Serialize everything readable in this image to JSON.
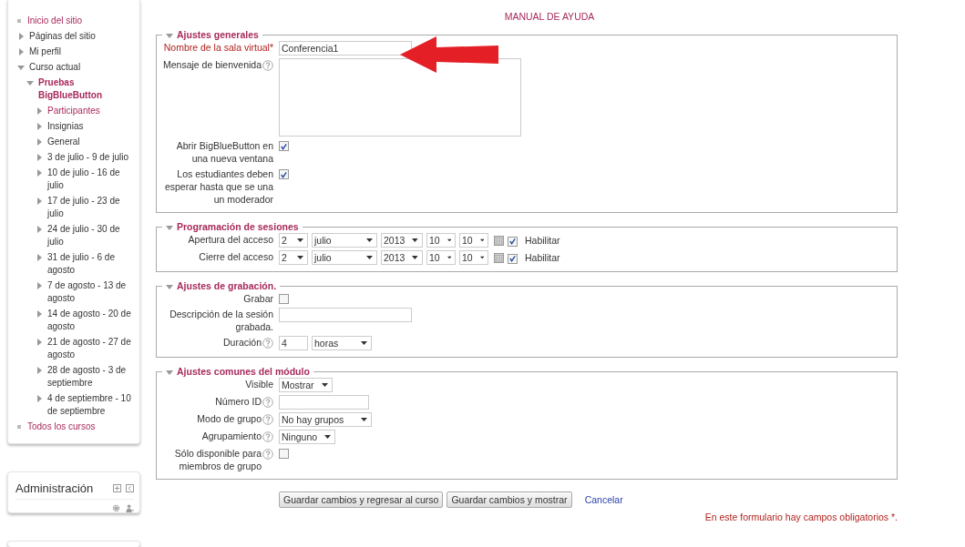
{
  "sidebar": {
    "nav_tree": [
      {
        "label": "Inicio del sitio",
        "kind": "leaf",
        "link": true
      },
      {
        "label": "Páginas del sitio",
        "kind": "branch",
        "expanded": false,
        "link": false
      },
      {
        "label": "Mi perfil",
        "kind": "branch",
        "expanded": false,
        "link": false
      },
      {
        "label": "Curso actual",
        "kind": "branch",
        "expanded": true,
        "link": false,
        "children": [
          {
            "label": "Pruebas BigBlueButton",
            "kind": "branch",
            "expanded": true,
            "link": true,
            "bold": true,
            "children": [
              {
                "label": "Participantes",
                "kind": "branch",
                "expanded": false,
                "link": true
              },
              {
                "label": "Insignias",
                "kind": "branch",
                "expanded": false,
                "link": false
              },
              {
                "label": "General",
                "kind": "branch",
                "expanded": false,
                "link": false
              },
              {
                "label": "3 de julio - 9 de julio",
                "kind": "branch",
                "expanded": false,
                "link": false
              },
              {
                "label": "10 de julio - 16 de julio",
                "kind": "branch",
                "expanded": false,
                "link": false
              },
              {
                "label": "17 de julio - 23 de julio",
                "kind": "branch",
                "expanded": false,
                "link": false
              },
              {
                "label": "24 de julio - 30 de julio",
                "kind": "branch",
                "expanded": false,
                "link": false
              },
              {
                "label": "31 de julio - 6 de agosto",
                "kind": "branch",
                "expanded": false,
                "link": false
              },
              {
                "label": "7 de agosto - 13 de agosto",
                "kind": "branch",
                "expanded": false,
                "link": false
              },
              {
                "label": "14 de agosto - 20 de agosto",
                "kind": "branch",
                "expanded": false,
                "link": false
              },
              {
                "label": "21 de agosto - 27 de agosto",
                "kind": "branch",
                "expanded": false,
                "link": false
              },
              {
                "label": "28 de agosto - 3 de septiembre",
                "kind": "branch",
                "expanded": false,
                "link": false
              },
              {
                "label": "4 de septiembre - 10 de septiembre",
                "kind": "branch",
                "expanded": false,
                "link": false
              }
            ]
          }
        ]
      },
      {
        "label": "Todos los cursos",
        "kind": "leaf",
        "link": true
      }
    ],
    "admin_block": {
      "title": "Administración"
    }
  },
  "main": {
    "title": "MANUAL DE AYUDA",
    "fieldsets": [
      {
        "legend": "Ajustes generales",
        "expanded": true,
        "fields": [
          {
            "kind": "text",
            "label": "Nombre de la sala virtual*",
            "required": true,
            "help": false,
            "value": "Conferencia1"
          },
          {
            "kind": "textarea",
            "label": "Mensaje de bienvenida",
            "required": false,
            "help": true
          },
          {
            "kind": "checkbox",
            "label": "Abrir BigBlueButton en una nueva ventana",
            "required": false,
            "help": false,
            "checked": true
          },
          {
            "kind": "checkbox",
            "label": "Los estudiantes deben esperar hasta que se una un moderador",
            "required": false,
            "help": false,
            "checked": true
          }
        ]
      },
      {
        "legend": "Programación de sesiones",
        "expanded": true,
        "fields": [
          {
            "kind": "datetime",
            "label": "Apertura del acceso",
            "required": false,
            "help": false,
            "day": "2",
            "month": "julio",
            "year": "2013",
            "hour": "10",
            "minute": "10",
            "enabled": true,
            "enable_label": "Habilitar"
          },
          {
            "kind": "datetime",
            "label": "Cierre del acceso",
            "required": false,
            "help": false,
            "day": "2",
            "month": "julio",
            "year": "2013",
            "hour": "10",
            "minute": "10",
            "enabled": true,
            "enable_label": "Habilitar"
          }
        ]
      },
      {
        "legend": "Ajustes de grabación.",
        "expanded": true,
        "fields": [
          {
            "kind": "checkbox",
            "label": "Grabar",
            "required": false,
            "help": false,
            "checked": false
          },
          {
            "kind": "text",
            "label": "Descripción de la sesión grabada.",
            "required": false,
            "help": false
          },
          {
            "kind": "duration",
            "label": "Duración",
            "required": false,
            "help": true,
            "value": "4",
            "unit": "horas"
          }
        ]
      },
      {
        "legend": "Ajustes comunes del módulo",
        "expanded": true,
        "fields": [
          {
            "kind": "select",
            "label": "Visible",
            "required": false,
            "help": false,
            "value": "Mostrar"
          },
          {
            "kind": "short_text",
            "label": "Número ID",
            "required": false,
            "help": true
          },
          {
            "kind": "wide_select",
            "label": "Modo de grupo",
            "required": false,
            "help": true,
            "value": "No hay grupos"
          },
          {
            "kind": "select",
            "label": "Agrupamiento",
            "required": false,
            "help": true,
            "value": "Ninguno"
          },
          {
            "kind": "checkbox",
            "label": "Sólo disponible para miembros de grupo",
            "required": false,
            "help": true,
            "checked": false
          }
        ]
      }
    ],
    "buttons": [
      "Guardar cambios y regresar al curso",
      "Guardar cambios y mostrar"
    ],
    "cancel_link": "Cancelar",
    "required_note": "En este formulario hay campos obligatorios *."
  }
}
